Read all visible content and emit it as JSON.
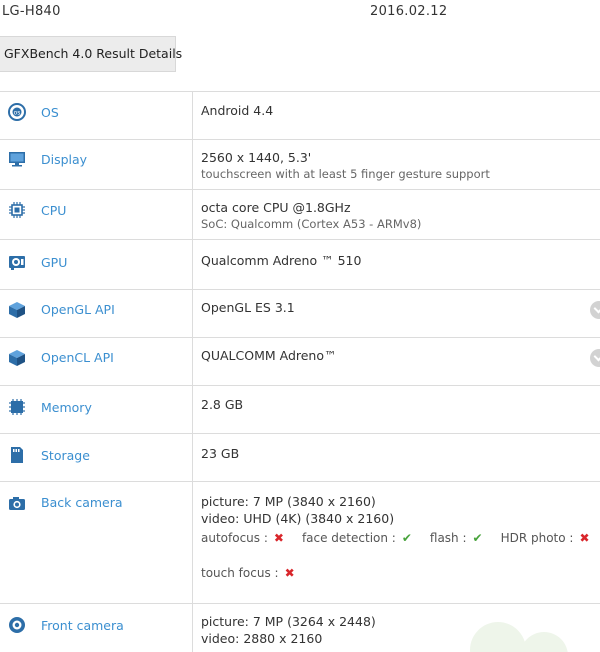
{
  "header": {
    "device": "LG-H840",
    "date": "2016.02.12"
  },
  "tab": {
    "label": "GFXBench 4.0 Result Details"
  },
  "specs": {
    "os": {
      "label": "OS",
      "value": "Android 4.4",
      "icon": "os-icon"
    },
    "display": {
      "label": "Display",
      "value": "2560 x 1440, 5.3'",
      "sub": "touchscreen with at least 5 finger gesture support",
      "icon": "monitor-icon"
    },
    "cpu": {
      "label": "CPU",
      "value": "octa core CPU @1.8GHz",
      "sub": "SoC: Qualcomm (Cortex A53 - ARMv8)",
      "icon": "cpu-chip-icon"
    },
    "gpu": {
      "label": "GPU",
      "value": "Qualcomm Adreno ™ 510",
      "icon": "gpu-icon"
    },
    "opengl": {
      "label": "OpenGL API",
      "value": "OpenGL ES 3.1",
      "icon": "cube-icon"
    },
    "opencl": {
      "label": "OpenCL API",
      "value": "QUALCOMM Adreno™",
      "icon": "cube-icon"
    },
    "memory": {
      "label": "Memory",
      "value": "2.8 GB",
      "icon": "memory-icon"
    },
    "storage": {
      "label": "Storage",
      "value": "23 GB",
      "icon": "sd-card-icon"
    },
    "back_camera": {
      "label": "Back camera",
      "picture": "picture: 7 MP (3840 x 2160)",
      "video": "video: UHD (4K) (3840 x 2160)",
      "features": [
        {
          "label": "autofocus :",
          "supported": false
        },
        {
          "label": "face detection :",
          "supported": true
        },
        {
          "label": "flash :",
          "supported": true
        },
        {
          "label": "HDR photo :",
          "supported": false
        }
      ],
      "touch_focus": {
        "label": "touch focus :",
        "supported": false
      },
      "icon": "camera-icon"
    },
    "front_camera": {
      "label": "Front camera",
      "picture": "picture: 7 MP (3264 x 2448)",
      "video": "video: 2880 x 2160",
      "icon": "front-camera-icon"
    }
  },
  "marks": {
    "yes": "✔",
    "no": "✖"
  },
  "colors": {
    "label_blue": "#3b8fd0",
    "yes_green": "#47a33b",
    "no_red": "#d9262b",
    "icon_blue": "#2d6ea8"
  }
}
